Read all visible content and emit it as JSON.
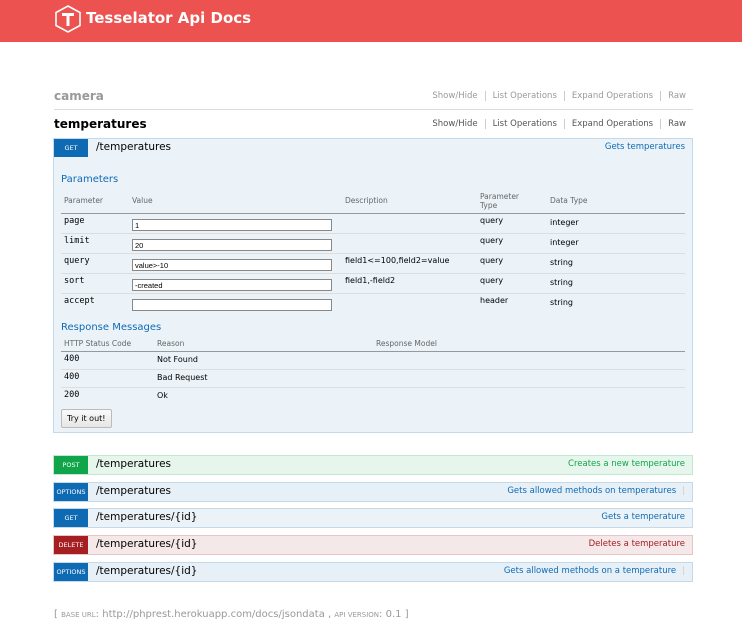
{
  "header": {
    "title": "Tesselator Api Docs",
    "bg_color": "#ec5250",
    "logo_icon": "tesselator-logo-icon"
  },
  "resources": [
    {
      "name": "camera",
      "links": [
        "Show/Hide",
        "List Operations",
        "Expand Operations",
        "Raw"
      ]
    },
    {
      "name": "temperatures",
      "links": [
        "Show/Hide",
        "List Operations",
        "Expand Operations",
        "Raw"
      ]
    }
  ],
  "expanded_op": {
    "method": "GET",
    "path": "/temperatures",
    "summary": "Gets temperatures",
    "parameters_title": "Parameters",
    "param_columns": [
      "Parameter",
      "Value",
      "Description",
      "Parameter Type",
      "Data Type"
    ],
    "params": [
      {
        "name": "page",
        "value": "1",
        "description": "",
        "type": "query",
        "data_type": "integer"
      },
      {
        "name": "limit",
        "value": "20",
        "description": "",
        "type": "query",
        "data_type": "integer"
      },
      {
        "name": "query",
        "value": "value>-10",
        "description": "field1<=100,field2=value",
        "type": "query",
        "data_type": "string"
      },
      {
        "name": "sort",
        "value": "-created",
        "description": "field1,-field2",
        "type": "query",
        "data_type": "string"
      },
      {
        "name": "accept",
        "value": "",
        "description": "",
        "type": "header",
        "data_type": "string"
      }
    ],
    "responses_title": "Response Messages",
    "response_columns": [
      "HTTP Status Code",
      "Reason",
      "Response Model"
    ],
    "responses": [
      {
        "code": "400",
        "reason": "Not Found"
      },
      {
        "code": "400",
        "reason": "Bad Request"
      },
      {
        "code": "200",
        "reason": "Ok"
      }
    ],
    "try_label": "Try it out!"
  },
  "operations": [
    {
      "method": "POST",
      "path": "/temperatures",
      "summary": "Creates a new temperature"
    },
    {
      "method": "OPTIONS",
      "path": "/temperatures",
      "summary": "Gets allowed methods on temperatures"
    },
    {
      "method": "GET",
      "path": "/temperatures/{id}",
      "summary": "Gets a temperature"
    },
    {
      "method": "DELETE",
      "path": "/temperatures/{id}",
      "summary": "Deletes a temperature"
    },
    {
      "method": "OPTIONS",
      "path": "/temperatures/{id}",
      "summary": "Gets allowed methods on a temperature"
    }
  ],
  "footer": {
    "open": "[",
    "base_url_label": "base url",
    "base_url": "http://phprest.herokuapp.com/docs/jsondata",
    "sep": ",",
    "api_version_label": "api version",
    "api_version": "0.1",
    "close": "]"
  }
}
